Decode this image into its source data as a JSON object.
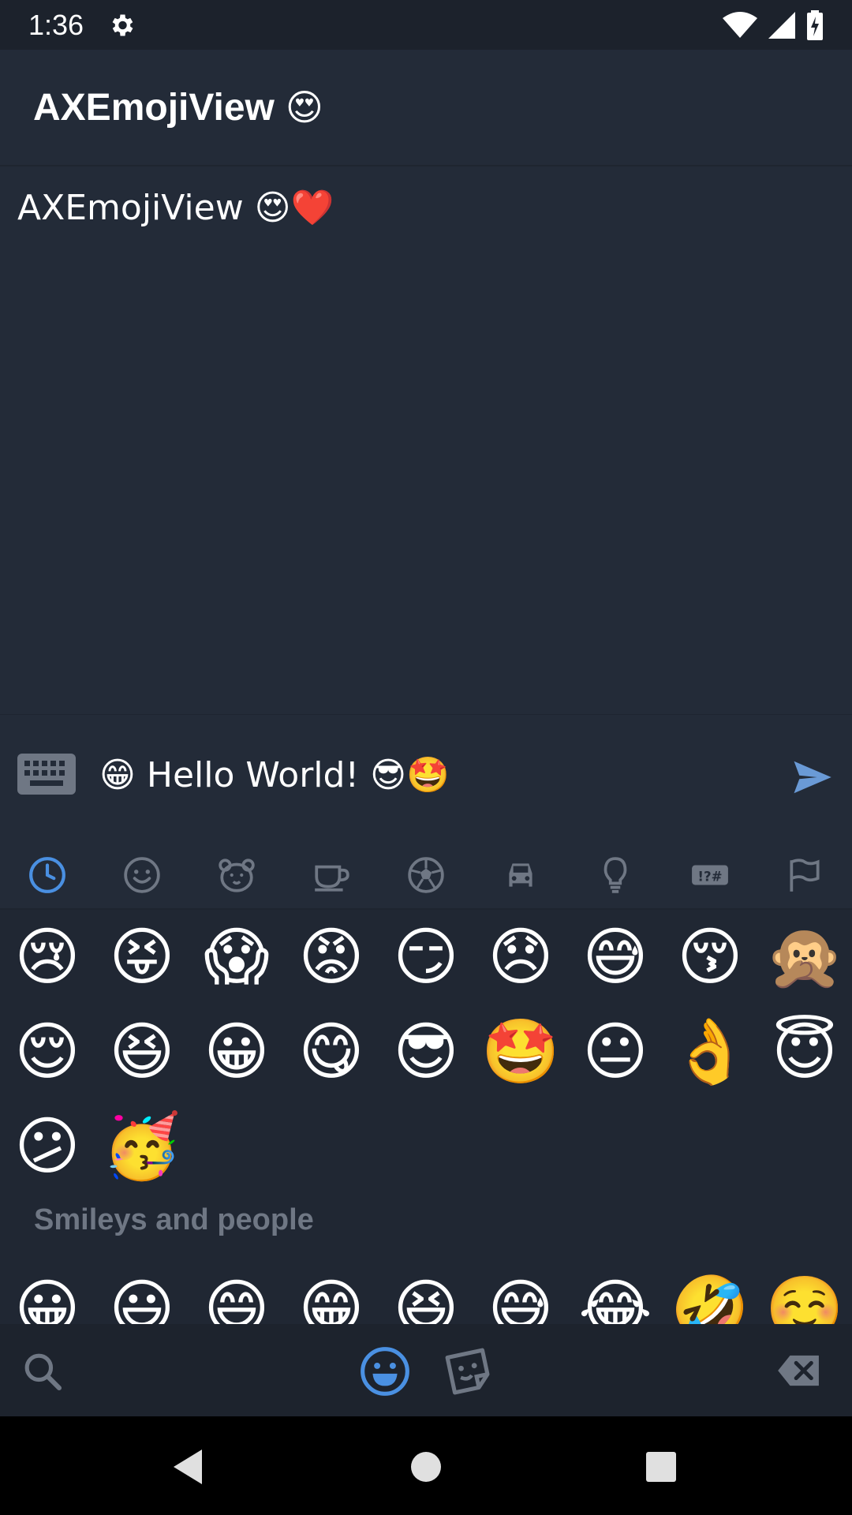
{
  "status_bar": {
    "time": "1:36"
  },
  "app_bar": {
    "title": "AXEmojiView",
    "title_emoji": "😍"
  },
  "content": {
    "message": "AXEmojiView 😍❤️"
  },
  "input": {
    "text": "😁 Hello World! 😎🤩"
  },
  "category_tabs": [
    {
      "name": "recent-icon",
      "selected": true
    },
    {
      "name": "smiley-icon",
      "selected": false
    },
    {
      "name": "animal-icon",
      "selected": false
    },
    {
      "name": "food-icon",
      "selected": false
    },
    {
      "name": "activity-icon",
      "selected": false
    },
    {
      "name": "travel-icon",
      "selected": false
    },
    {
      "name": "objects-icon",
      "selected": false
    },
    {
      "name": "symbols-icon",
      "selected": false
    },
    {
      "name": "flags-icon",
      "selected": false
    }
  ],
  "recent_emojis": {
    "row1": [
      "😢",
      "😝",
      "😱",
      "😡",
      "😏",
      "😞",
      "😅",
      "😚",
      "🙊"
    ],
    "row2": [
      "😌",
      "😆",
      "😀",
      "😋",
      "😎",
      "🤩",
      "😐",
      "👌",
      "😇"
    ],
    "row3": [
      "😕",
      "🥳"
    ]
  },
  "section": {
    "title": "Smileys and people"
  },
  "smileys_row": [
    "😀",
    "😃",
    "😄",
    "😁",
    "😆",
    "😅",
    "😂",
    "🤣",
    "☺️"
  ],
  "colors": {
    "background": "#232b38",
    "accent": "#4a90e2",
    "icon_gray": "#6f7784"
  }
}
